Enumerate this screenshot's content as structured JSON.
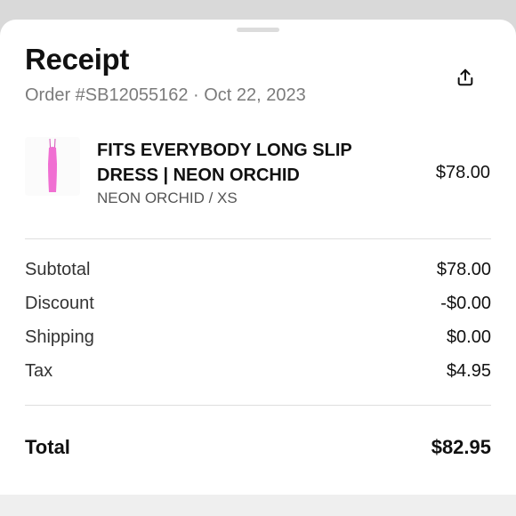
{
  "receipt": {
    "title": "Receipt",
    "order_line": "Order #SB12055162 · Oct 22, 2023",
    "share_icon": "share-icon"
  },
  "item": {
    "name": "FITS EVERYBODY LONG SLIP DRESS | NEON ORCHID",
    "variant": "NEON ORCHID / XS",
    "price": "$78.00",
    "color": "#f06fd2"
  },
  "summary": {
    "rows": [
      {
        "label": "Subtotal",
        "value": "$78.00"
      },
      {
        "label": "Discount",
        "value": "-$0.00"
      },
      {
        "label": "Shipping",
        "value": "$0.00"
      },
      {
        "label": "Tax",
        "value": "$4.95"
      }
    ],
    "total_label": "Total",
    "total_value": "$82.95"
  }
}
